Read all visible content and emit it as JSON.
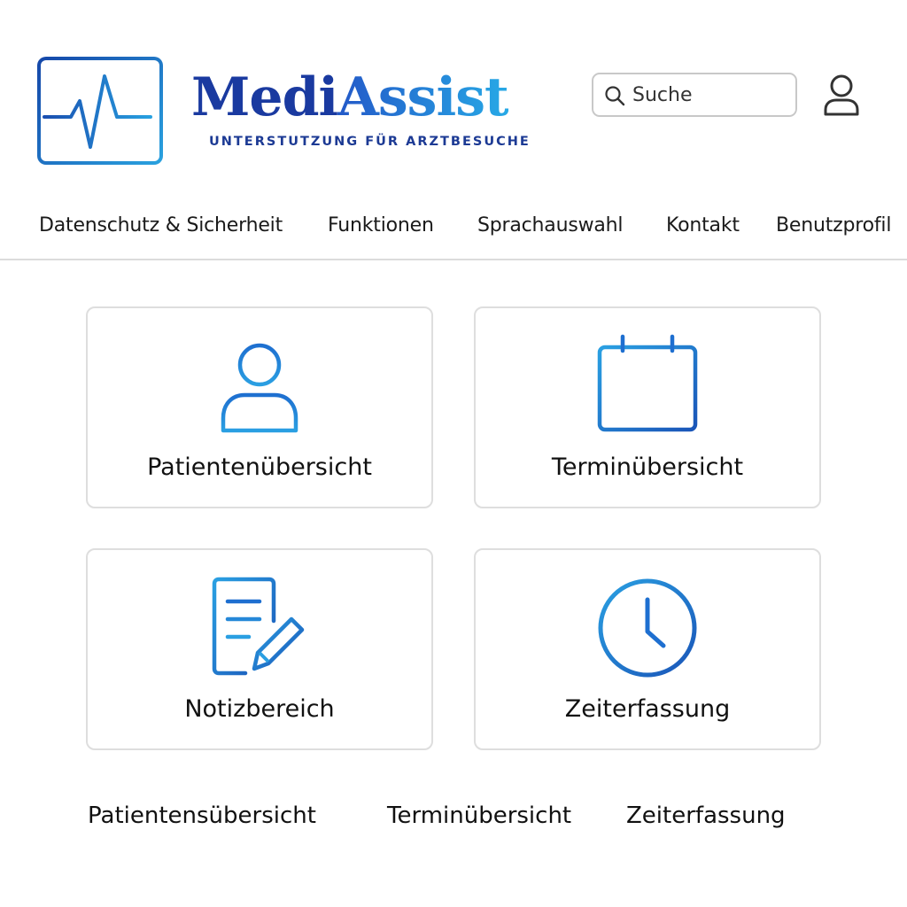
{
  "header": {
    "brand_part1": "Medi",
    "brand_part2": "Assist",
    "tagline": "UNTERSTUTZUNG FÜR ARZTBESUCHE",
    "logo_icon": "heartbeat-monitor-icon",
    "search": {
      "placeholder": "Suche",
      "icon": "search-icon"
    },
    "profile_icon": "user-icon"
  },
  "nav": {
    "items": [
      {
        "label": "Datenschutz & Sicherheit"
      },
      {
        "label": "Funktionen"
      },
      {
        "label": "Sprachauswahl"
      },
      {
        "label": "Kontakt"
      },
      {
        "label": "Benutzprofil"
      }
    ]
  },
  "cards": [
    {
      "label": "Patientenübersicht",
      "icon": "user-icon"
    },
    {
      "label": "Terminübersicht",
      "icon": "calendar-icon"
    },
    {
      "label": "Notizbereich",
      "icon": "notes-edit-icon"
    },
    {
      "label": "Zeiterfassung",
      "icon": "clock-icon"
    }
  ],
  "footer_links": [
    {
      "label": "Patientensübersicht"
    },
    {
      "label": "Terminübersicht"
    },
    {
      "label": "Zeiterfassung"
    }
  ],
  "colors": {
    "brand_dark": "#1a3aa0",
    "brand_light": "#27a9e6",
    "icon_blue": "#1f7fd6",
    "border_gray": "#dedede"
  }
}
